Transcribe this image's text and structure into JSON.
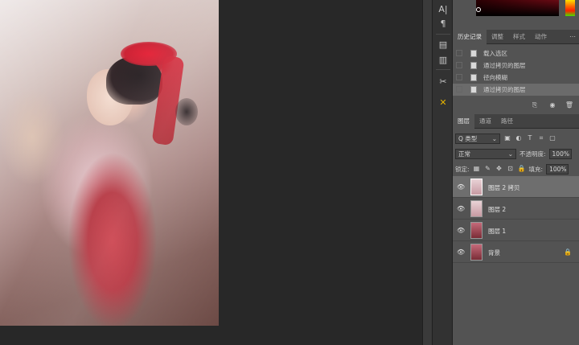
{
  "tools": {
    "items": [
      "A|",
      "¶",
      "▤",
      "▥",
      "✂",
      "✕"
    ]
  },
  "panels": {
    "history": {
      "tabs": [
        "历史记录",
        "调整",
        "样式",
        "动作"
      ],
      "extra": "⋯",
      "steps": [
        {
          "label": "载入选区"
        },
        {
          "label": "通过拷贝的图层"
        },
        {
          "label": "径向模糊"
        },
        {
          "label": "通过拷贝的图层"
        }
      ],
      "selected_index": 3,
      "footer_icons": [
        "⎘",
        "◉",
        "🗑"
      ]
    },
    "layers": {
      "tabs": [
        "图层",
        "通道",
        "路径"
      ],
      "filter_label": "Q 类型",
      "blend_mode": "正常",
      "opacity_label": "不透明度:",
      "opacity_value": "100%",
      "lock_label": "锁定:",
      "fill_label": "填充:",
      "fill_value": "100%",
      "items": [
        {
          "name": "图层 2 拷贝",
          "eye": "👁"
        },
        {
          "name": "图层 2",
          "eye": "👁"
        },
        {
          "name": "图层 1",
          "eye": "👁"
        },
        {
          "name": "背景",
          "eye": "👁",
          "lock": "🔒"
        }
      ],
      "selected_index": 0
    }
  },
  "colors": {
    "panel_bg": "#535353",
    "tab_bg": "#424242",
    "canvas_bg": "#282828",
    "accent_tool": "#e6b400"
  }
}
